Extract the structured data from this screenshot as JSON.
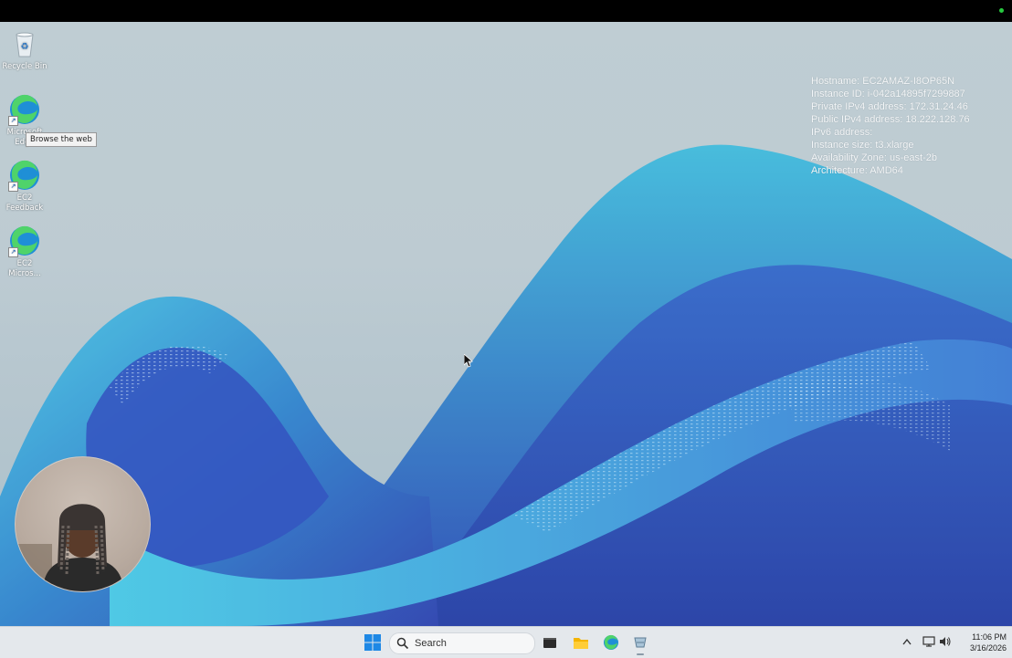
{
  "desktop_icons": [
    {
      "label": "Recycle Bin",
      "icon": "recycle-bin-icon"
    },
    {
      "label_line1": "Microsoft",
      "label_line2": "Edge",
      "icon": "edge-icon"
    },
    {
      "label_line1": "EC2",
      "label_line2": "Feedback",
      "icon": "edge-icon"
    },
    {
      "label_line1": "EC2",
      "label_line2": "Micros...",
      "icon": "edge-icon"
    }
  ],
  "tooltip": "Browse the web",
  "system_info": {
    "hostname": "Hostname: EC2AMAZ-I8OP65N",
    "instance_id": "Instance ID: i-042a14895f7299887",
    "private_ipv4": "Private IPv4 address: 172.31.24.46",
    "public_ipv4": "Public IPv4 address: 18.222.128.76",
    "ipv6": "IPv6 address:",
    "instance_size": "Instance size: t3.xlarge",
    "availability_zone": "Availability Zone: us-east-2b",
    "architecture": "Architecture: AMD64"
  },
  "taskbar": {
    "search_label": "Search",
    "time": "11:06 PM",
    "date": "3/16/2026",
    "icons": [
      "windows-start-icon",
      "search-icon",
      "terminal-icon",
      "file-explorer-icon",
      "edge-icon",
      "network-drive-icon"
    ],
    "tray_icons": [
      "chevron-up-icon",
      "network-icon",
      "volume-icon"
    ]
  },
  "colors": {
    "wallpaper_deep_blue": "#1f3fb8",
    "wallpaper_teal": "#2aa6c9",
    "taskbar_bg": "#e4e8ec",
    "recording_dot": "#27c93f"
  }
}
